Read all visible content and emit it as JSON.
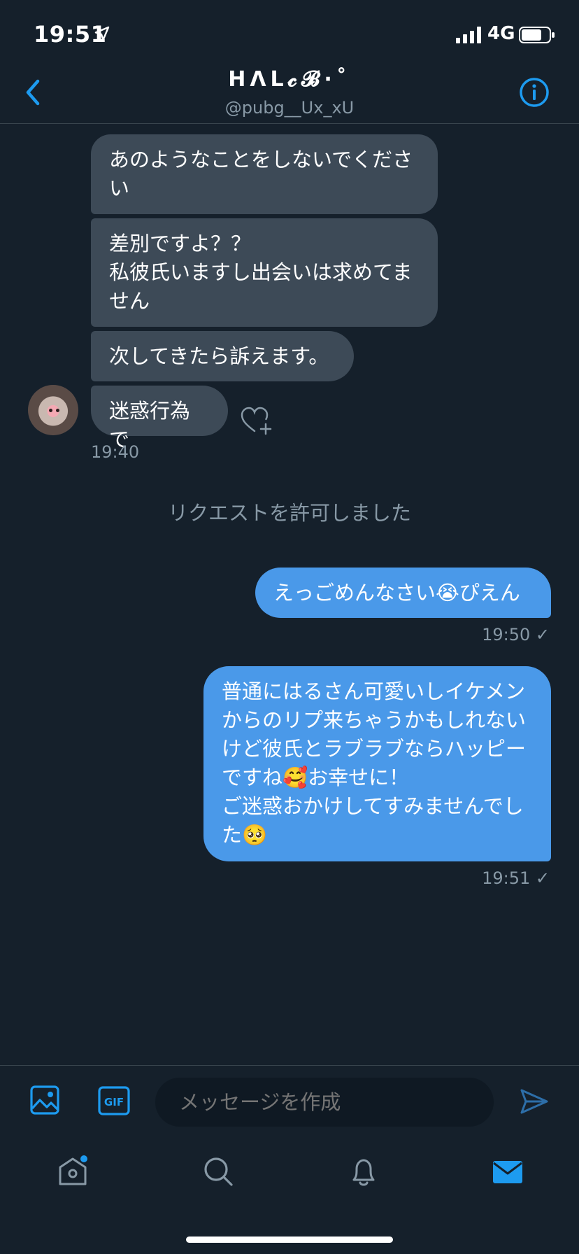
{
  "status_bar": {
    "time": "19:51",
    "network": "4G"
  },
  "header": {
    "title": "HΛL𝓬𝓑·˚",
    "handle": "@pubg__Ux_xU"
  },
  "messages_in": [
    {
      "text": "あのようなことをしないでくださ\nい"
    },
    {
      "text": "差別ですよ？？\n私彼氏いますし出会いは求めてま\nせん"
    },
    {
      "text": "次してきたら訴えます。"
    },
    {
      "text": "迷惑行為で"
    }
  ],
  "in_time": "19:40",
  "system_message": "リクエストを許可しました",
  "messages_out": [
    {
      "text": "えっごめんなさい😭ぴえん",
      "time": "19:50 ✓"
    },
    {
      "text": "普通にはるさん可愛いしイケメン\nからのリプ来ちゃうかもしれない\nけど彼氏とラブラブならハッピー\nですね🥰お幸せに！\nご迷惑おかけしてすみませんでし\nた🥺",
      "time": "19:51 ✓"
    }
  ],
  "composer": {
    "placeholder": "メッセージを作成",
    "gif_label": "GIF"
  },
  "tabs": [
    "home-icon",
    "search-icon",
    "notifications-icon",
    "messages-icon"
  ],
  "colors": {
    "background": "#15202b",
    "accent": "#1d9bf0",
    "bubble_out": "#4a99e9",
    "bubble_in": "#3d4a57"
  }
}
